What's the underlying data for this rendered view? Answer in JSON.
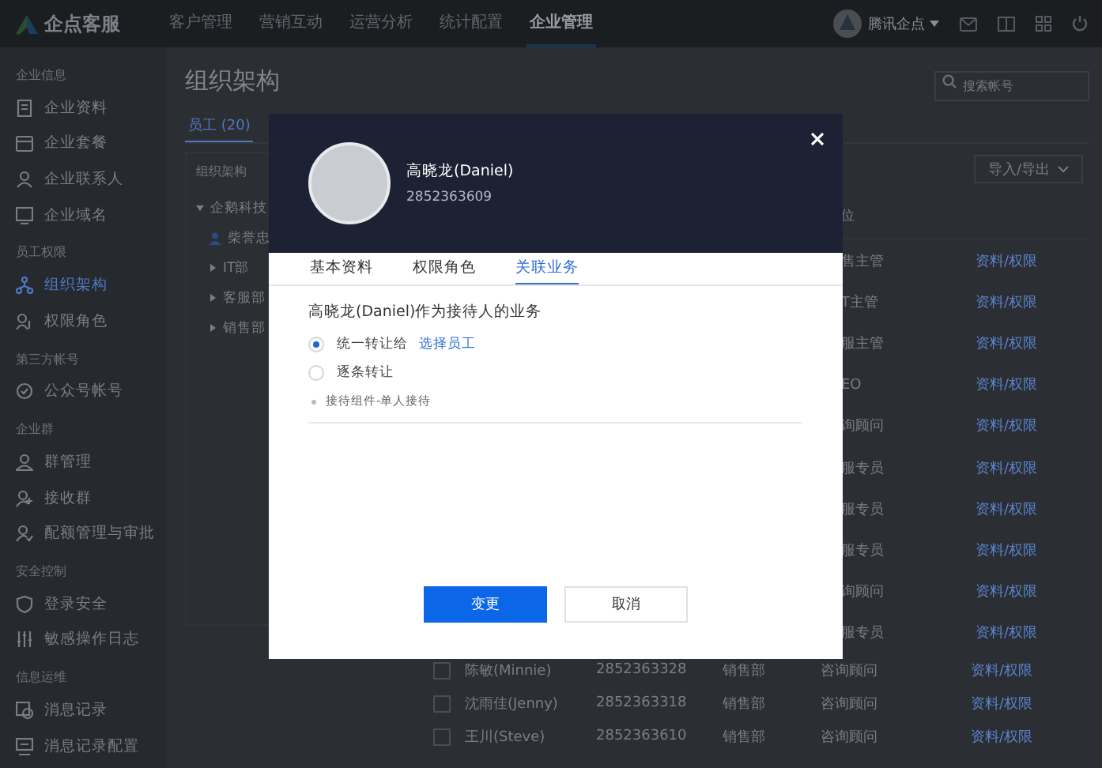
{
  "topbar": {
    "logo": "企点客服",
    "nav": [
      {
        "label": "客户管理",
        "selected": false
      },
      {
        "label": "营销互动",
        "selected": false
      },
      {
        "label": "运营分析",
        "selected": false
      },
      {
        "label": "统计配置",
        "selected": false
      },
      {
        "label": "企业管理",
        "selected": true
      }
    ],
    "account": "腾讯企点"
  },
  "sidebar": {
    "sections": [
      {
        "title": "企业信息",
        "items": [
          {
            "label": "企业资料",
            "selected": false
          },
          {
            "label": "企业套餐",
            "selected": false
          },
          {
            "label": "企业联系人",
            "selected": false
          },
          {
            "label": "企业域名",
            "selected": false
          }
        ]
      },
      {
        "title": "员工权限",
        "items": [
          {
            "label": "组织架构",
            "selected": true
          },
          {
            "label": "权限角色",
            "selected": false
          }
        ]
      },
      {
        "title": "第三方帐号",
        "items": [
          {
            "label": "公众号帐号",
            "selected": false
          }
        ]
      },
      {
        "title": "企业群",
        "items": [
          {
            "label": "群管理",
            "selected": false
          },
          {
            "label": "接收群",
            "selected": false
          },
          {
            "label": "配额管理与审批",
            "selected": false
          }
        ]
      },
      {
        "title": "安全控制",
        "items": [
          {
            "label": "登录安全",
            "selected": false
          },
          {
            "label": "敏感操作日志",
            "selected": false
          }
        ]
      },
      {
        "title": "信息运维",
        "items": [
          {
            "label": "消息记录",
            "selected": false
          },
          {
            "label": "消息记录配置",
            "selected": false
          }
        ]
      }
    ]
  },
  "page": {
    "title": "组织架构",
    "search": {
      "placeholder": "搜索帐号"
    },
    "tab": "员工 (20)",
    "export_button": "导入/导出"
  },
  "tree": {
    "title": "组织架构",
    "root": {
      "label": "企鹅科技",
      "expanded": true,
      "children": [
        {
          "label": "柴誉忠",
          "kind": "person"
        },
        {
          "label": "IT部",
          "kind": "group"
        },
        {
          "label": "客服部",
          "kind": "group"
        },
        {
          "label": "销售部",
          "kind": "group"
        }
      ]
    }
  },
  "table": {
    "header_visible": "位",
    "rows_behind_dialog": [
      {
        "position": "售主管",
        "action": "资料/权限"
      },
      {
        "position": "T主管",
        "action": "资料/权限"
      },
      {
        "position": "服主管",
        "action": "资料/权限"
      },
      {
        "position": "EO",
        "action": "资料/权限"
      },
      {
        "position": "询顾问",
        "action": "资料/权限"
      },
      {
        "position": "服专员",
        "action": "资料/权限"
      },
      {
        "position": "服专员",
        "action": "资料/权限"
      },
      {
        "position": "服专员",
        "action": "资料/权限"
      },
      {
        "position": "询顾问",
        "action": "资料/权限"
      },
      {
        "position": "服专员",
        "action": "资料/权限"
      }
    ],
    "rows": [
      {
        "checked": false,
        "name": "陈敏(Minnie)",
        "account": "2852363328",
        "department": "销售部",
        "position": "咨询顾问",
        "action": "资料/权限"
      },
      {
        "checked": false,
        "name": "沈雨佳(Jenny)",
        "account": "2852363318",
        "department": "销售部",
        "position": "咨询顾问",
        "action": "资料/权限"
      },
      {
        "checked": false,
        "name": "王川(Steve)",
        "account": "2852363610",
        "department": "销售部",
        "position": "咨询顾问",
        "action": "资料/权限"
      }
    ]
  },
  "dialog": {
    "name": "高晓龙(Daniel)",
    "account": "2852363609",
    "tabs": [
      {
        "label": "基本资料",
        "selected": false
      },
      {
        "label": "权限角色",
        "selected": false
      },
      {
        "label": "关联业务",
        "selected": true
      }
    ],
    "heading": "高晓龙(Daniel)作为接待人的业务",
    "options": [
      {
        "label": "统一转让给",
        "selected": true,
        "link": "选择员工"
      },
      {
        "label": "逐条转让",
        "selected": false
      }
    ],
    "items": [
      "接待组件-单人接待"
    ],
    "confirm": "变更",
    "cancel": "取消"
  }
}
